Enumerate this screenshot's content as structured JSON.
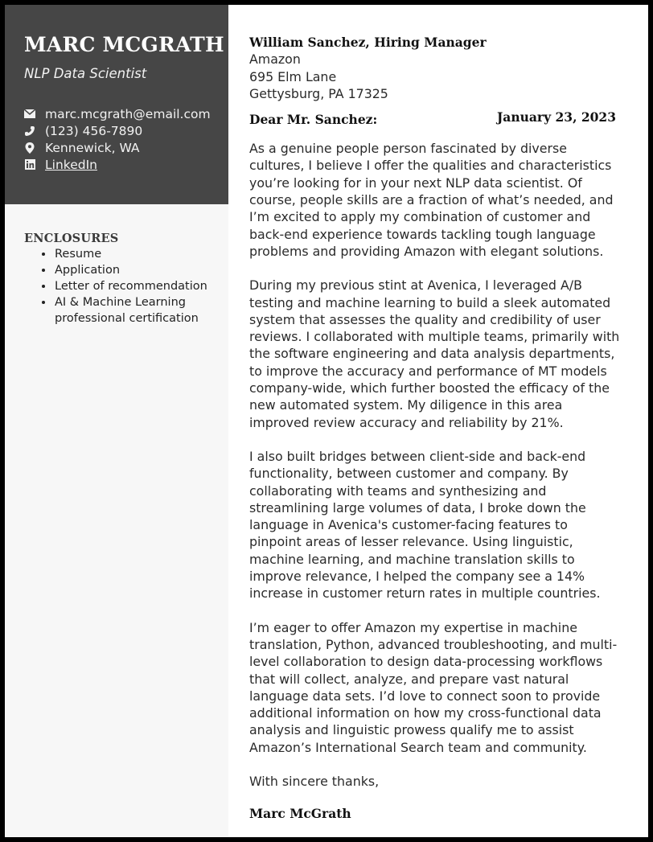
{
  "sidebar": {
    "name": "MARC MCGRATH",
    "title": "NLP Data Scientist",
    "contacts": [
      {
        "icon": "mail-icon",
        "text": "marc.mcgrath@email.com"
      },
      {
        "icon": "phone-icon",
        "text": "(123) 456-7890"
      },
      {
        "icon": "location-pin-icon",
        "text": "Kennewick, WA"
      },
      {
        "icon": "linkedin-icon",
        "text": "LinkedIn"
      }
    ],
    "enclosures": {
      "heading": "ENCLOSURES",
      "items": [
        "Resume",
        "Application",
        "Letter of recommendation",
        "AI & Machine Learning professional certification"
      ]
    }
  },
  "letter": {
    "recipient": {
      "name": "William Sanchez, Hiring Manager",
      "company": "Amazon",
      "street": "695 Elm Lane",
      "city": "Gettysburg, PA 17325"
    },
    "date": "January 23, 2023",
    "salutation": "Dear Mr. Sanchez:",
    "paragraphs": [
      "As a genuine people person fascinated by diverse cultures, I believe I offer the qualities and characteristics you’re looking for in your next NLP data scientist. Of course, people skills are a fraction of what’s needed, and I’m excited to apply my combination of customer and back-end experience towards tackling tough language problems and providing Amazon with elegant solutions.",
      "During my previous stint at Avenica, I leveraged A/B testing and machine learning to build a sleek automated system that assesses the quality and credibility of user reviews. I collaborated with multiple teams, primarily with the software engineering and data analysis departments, to improve the accuracy and performance of MT models company-wide, which further boosted the efficacy of the new automated system. My diligence in this area improved review accuracy and reliability by 21%.",
      "I also built bridges between client-side and back-end functionality, between customer and company. By collaborating with teams and synthesizing and streamlining large volumes of data, I broke down the language in Avenica's customer-facing features to pinpoint areas of lesser relevance. Using linguistic, machine learning, and machine translation skills to improve relevance, I helped the company see a 14% increase in customer return rates in multiple countries.",
      "I’m eager to offer Amazon my expertise in machine translation, Python, advanced troubleshooting, and multi-level collaboration to design data-processing workflows that will collect, analyze, and prepare vast natural language data sets. I’d love to connect soon to provide additional information on how my cross-functional data analysis and linguistic prowess qualify me to assist Amazon’s International Search team and community."
    ],
    "closing": "With sincere thanks,",
    "signature": "Marc McGrath"
  }
}
